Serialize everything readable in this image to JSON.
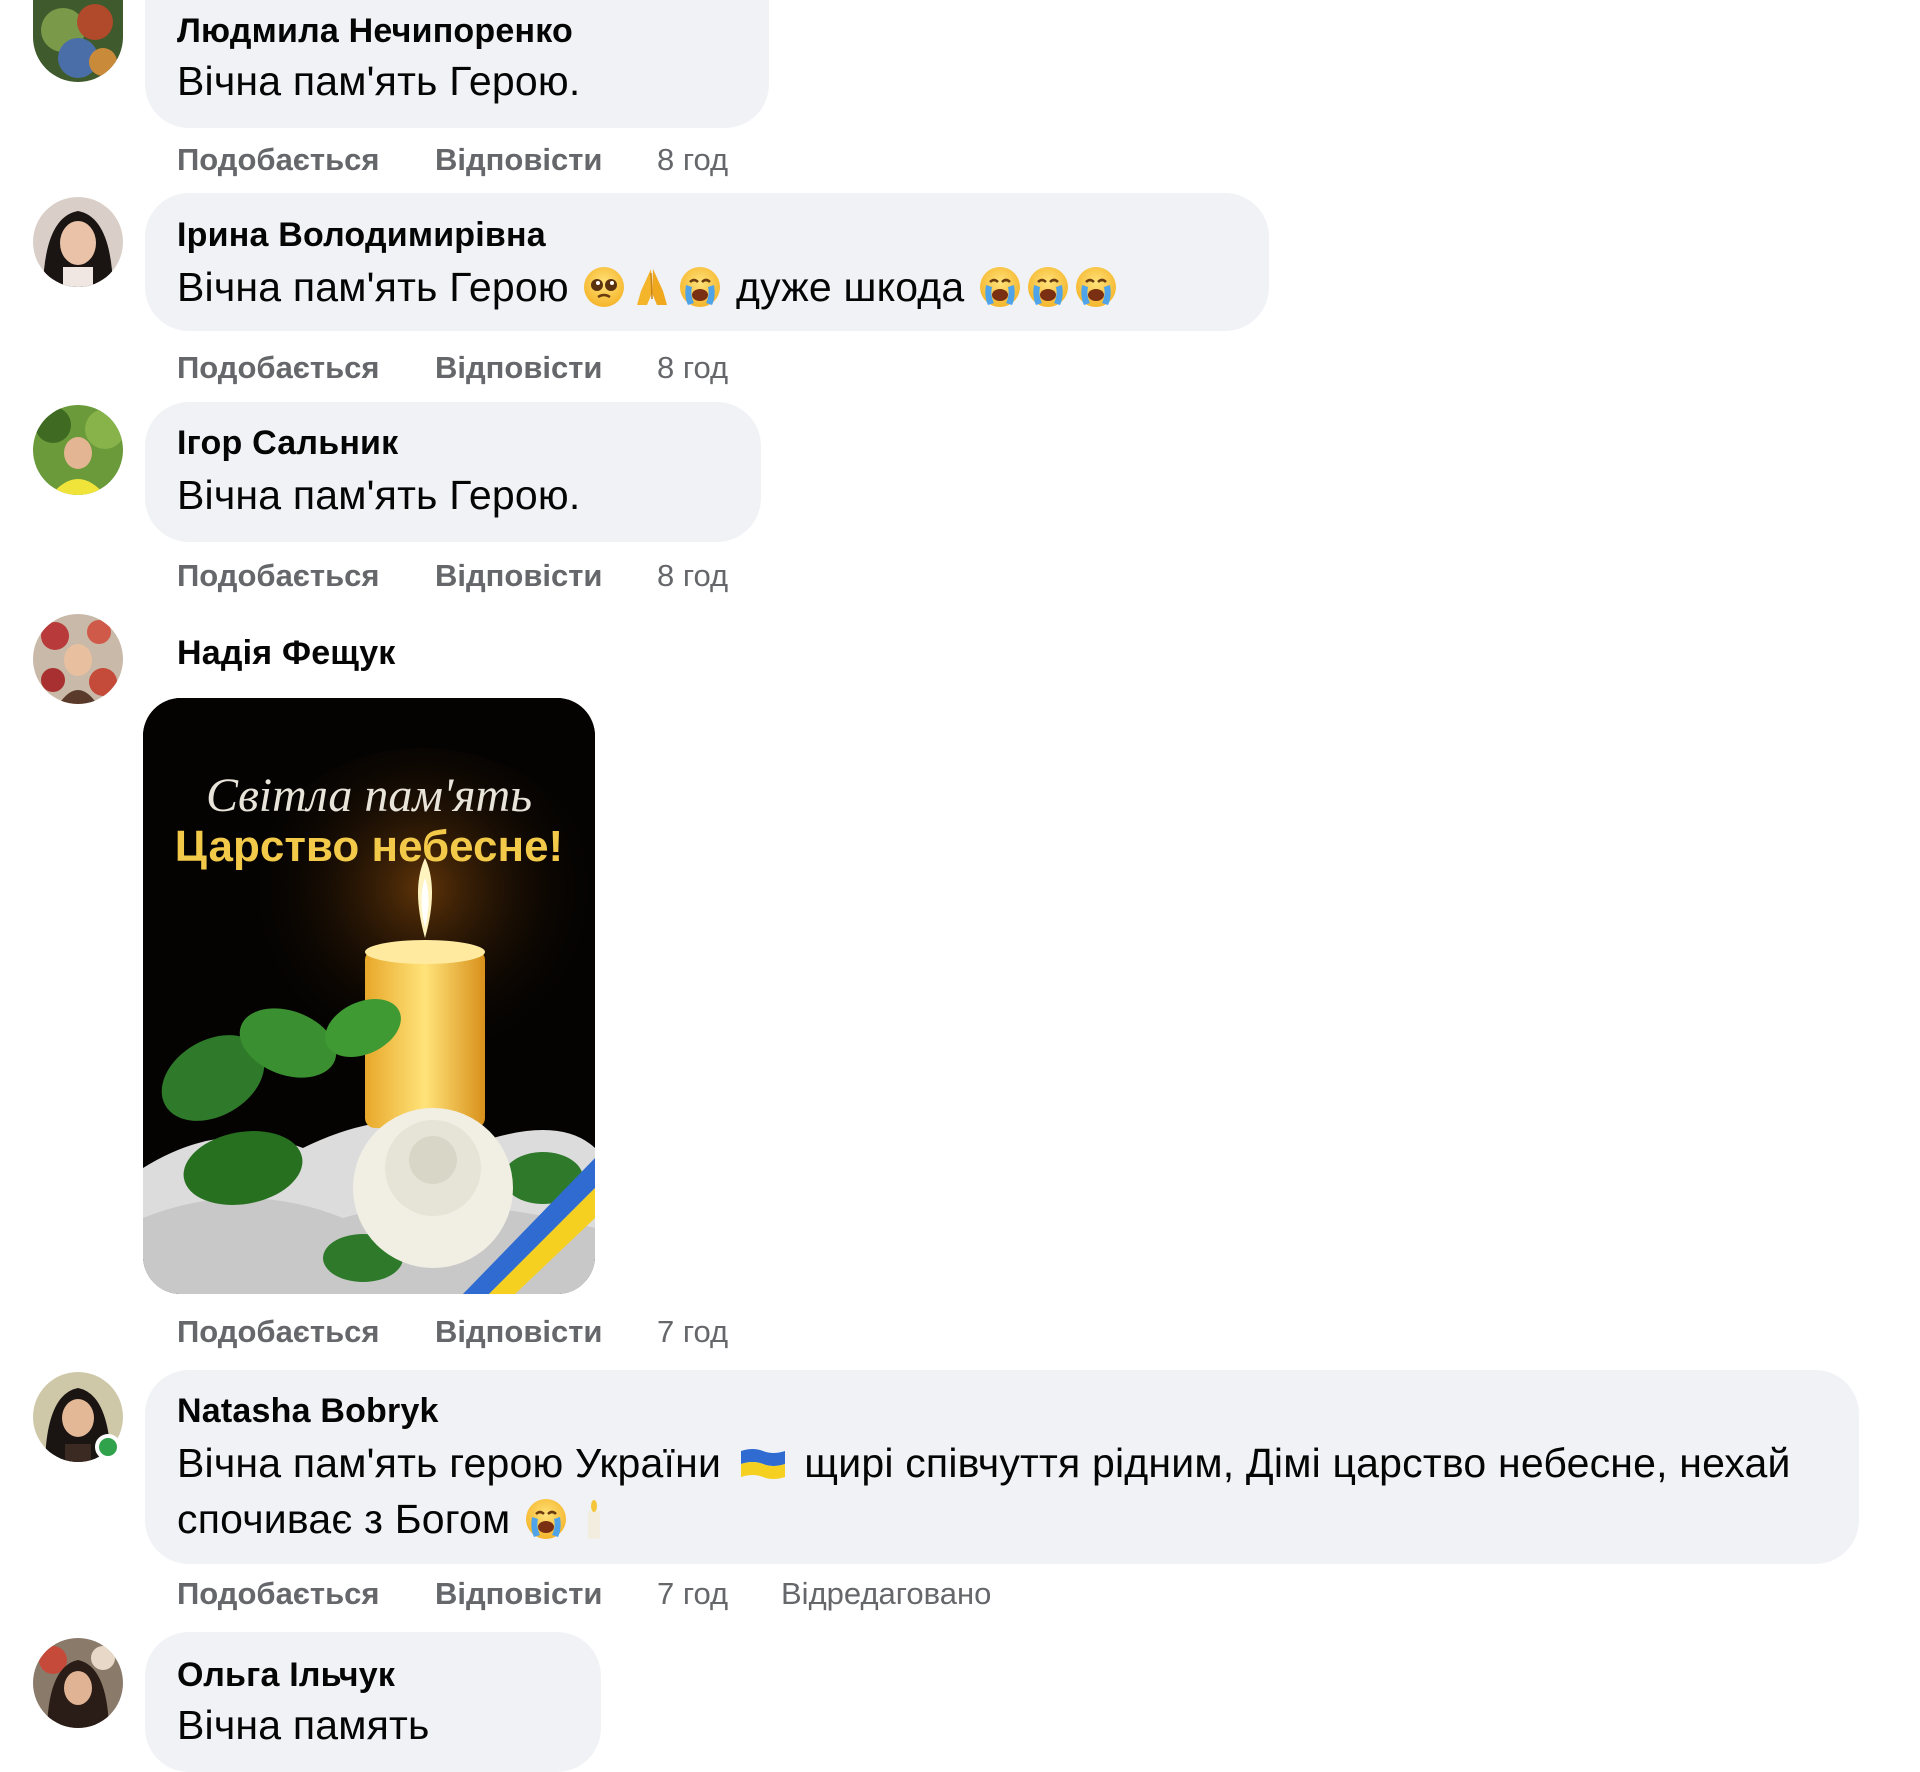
{
  "actions": {
    "like": "Подобається",
    "reply": "Відповісти"
  },
  "comments": [
    {
      "author": "Людмила Нечипоренко",
      "text": "Вічна пам'ять Герою.",
      "time": "8 год"
    },
    {
      "author": "Ірина Володимирівна",
      "text_before": "Вічна пам'ять Герою",
      "text_middle": "дуже шкода",
      "time": "8 год",
      "emojis": [
        "pleading-face",
        "folded-hands",
        "crying-face",
        "crying-face",
        "crying-face",
        "crying-face"
      ]
    },
    {
      "author": "Ігор Сальник",
      "text": "Вічна пам'ять Герою.",
      "time": "8 год"
    },
    {
      "author": "Надія Фещук",
      "time": "7 год",
      "image": {
        "caption_line1": "Світла пам'ять",
        "caption_line2": "Царство небесне!"
      }
    },
    {
      "author": "Natasha Bobryk",
      "text_line1_before": "Вічна пам'ять герою України",
      "text_line1_after": "щирі співчуття рідним, Дімі царство небесне, нехай",
      "text_line2": "спочиває з Богом",
      "time": "7 год",
      "edited": "Відредаговано",
      "emojis": [
        "ukraine-flag",
        "crying-face",
        "candle"
      ]
    },
    {
      "author": "Ольга Ільчук",
      "text": "Вічна память"
    }
  ],
  "colors": {
    "bubble": "#f0f2f5",
    "meta": "#65676b",
    "online": "#31a24c"
  }
}
